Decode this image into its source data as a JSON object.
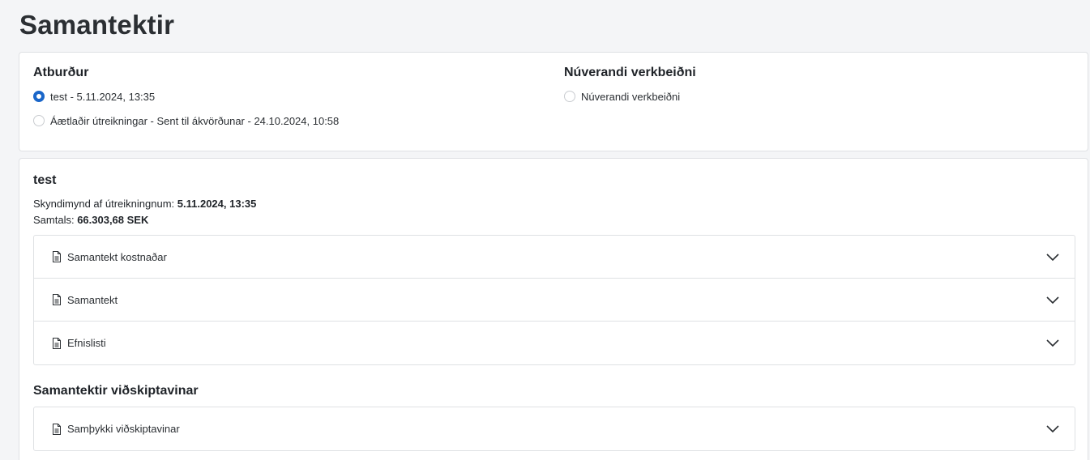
{
  "page": {
    "title": "Samantektir"
  },
  "events": {
    "heading": "Atburður",
    "options": [
      {
        "label": "test - 5.11.2024, 13:35",
        "selected": true
      },
      {
        "label": "Áætlaðir útreikningar - Sent til ákvörðunar - 24.10.2024, 10:58",
        "selected": false
      }
    ]
  },
  "current_work_order": {
    "heading": "Núverandi verkbeiðni",
    "options": [
      {
        "label": "Núverandi verkbeiðni",
        "selected": false
      }
    ]
  },
  "detail": {
    "title": "test",
    "snapshot_label": "Skyndimynd af útreikningnum: ",
    "snapshot_value": "5.11.2024, 13:35",
    "total_label": "Samtals: ",
    "total_value": "66.303,68 SEK",
    "sections": [
      {
        "label": "Samantekt kostnaðar",
        "icon": "document-icon"
      },
      {
        "label": "Samantekt",
        "icon": "document-icon"
      },
      {
        "label": "Efnislisti",
        "icon": "document-icon"
      }
    ]
  },
  "client_summaries": {
    "heading": "Samantektir viðskiptavinar",
    "sections": [
      {
        "label": "Samþykki viðskiptavinar",
        "icon": "document-icon"
      }
    ]
  },
  "colors": {
    "accent": "#1a66c9",
    "background": "#f4f5f7",
    "border": "#dfe1e4"
  }
}
